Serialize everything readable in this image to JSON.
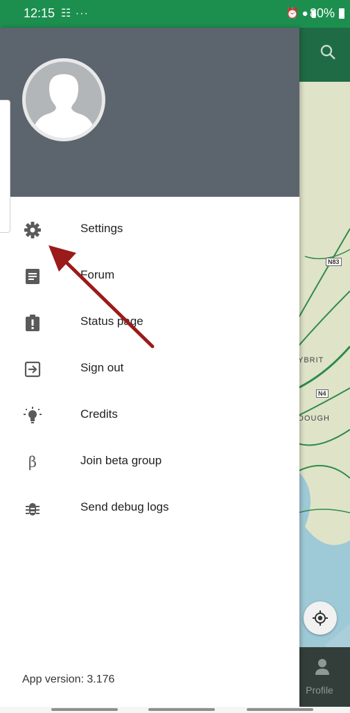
{
  "status_bar": {
    "time": "12:15",
    "notification_icons": "☷ ···",
    "system_icons": "⏰ ● ▮",
    "battery": "80%"
  },
  "drawer": {
    "menu": [
      {
        "label": "Settings",
        "icon": "gear-icon"
      },
      {
        "label": "Forum",
        "icon": "forum-icon"
      },
      {
        "label": "Status page",
        "icon": "status-icon"
      },
      {
        "label": "Sign out",
        "icon": "sign-out-icon"
      },
      {
        "label": "Credits",
        "icon": "lightbulb-icon"
      },
      {
        "label": "Join beta group",
        "icon": "beta-icon",
        "glyph": "β"
      },
      {
        "label": "Send debug logs",
        "icon": "bug-icon"
      }
    ],
    "app_version": "App version: 3.176"
  },
  "map": {
    "road_labels": [
      "N83",
      "N4"
    ],
    "place_labels": [
      "YBRIT",
      "DOUGH"
    ],
    "profile_label": "Profile"
  },
  "colors": {
    "status_bar": "#1c8f4f",
    "header": "#5c646e",
    "arrow": "#9b1a1a"
  }
}
